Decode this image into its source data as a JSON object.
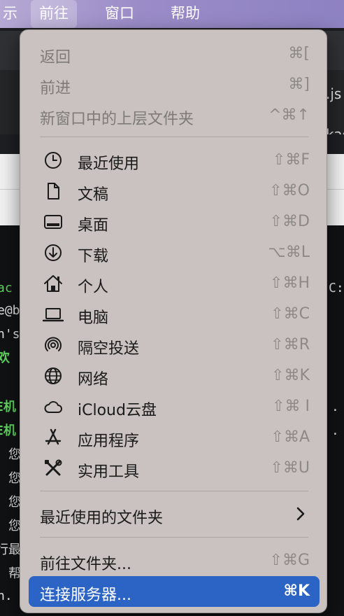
{
  "menubar": {
    "items": [
      {
        "label": "示"
      },
      {
        "label": "前往"
      },
      {
        "label": "窗口"
      },
      {
        "label": "帮助"
      }
    ]
  },
  "menu": {
    "back": {
      "label": "返回",
      "shortcut": "⌘["
    },
    "forward": {
      "label": "前进",
      "shortcut": "⌘]"
    },
    "parent": {
      "label": "新窗口中的上层文件夹",
      "shortcut": "^⌘↑"
    },
    "places": [
      {
        "label": "最近使用",
        "shortcut": "⇧⌘F",
        "icon": "clock-icon"
      },
      {
        "label": "文稿",
        "shortcut": "⇧⌘O",
        "icon": "document-icon"
      },
      {
        "label": "桌面",
        "shortcut": "⇧⌘D",
        "icon": "desktop-icon"
      },
      {
        "label": "下载",
        "shortcut": "⌥⌘L",
        "icon": "download-icon"
      },
      {
        "label": "个人",
        "shortcut": "⇧⌘H",
        "icon": "home-icon"
      },
      {
        "label": "电脑",
        "shortcut": "⇧⌘C",
        "icon": "laptop-icon"
      },
      {
        "label": "隔空投送",
        "shortcut": "⇧⌘R",
        "icon": "airdrop-icon"
      },
      {
        "label": "网络",
        "shortcut": "⇧⌘K",
        "icon": "globe-icon"
      },
      {
        "label": "iCloud云盘",
        "shortcut": "⇧⌘ I",
        "icon": "cloud-icon"
      },
      {
        "label": "应用程序",
        "shortcut": "⇧⌘A",
        "icon": "applications-icon"
      },
      {
        "label": "实用工具",
        "shortcut": "⇧⌘U",
        "icon": "utilities-icon"
      }
    ],
    "recent_folders": {
      "label": "最近使用的文件夹"
    },
    "go_to_folder": {
      "label": "前往文件夹...",
      "shortcut": "⇧⌘G"
    },
    "connect_server": {
      "label": "连接服务器...",
      "shortcut": "⌘K"
    }
  },
  "background": {
    "right_fragments": [
      ".js",
      "kag",
      "C:"
    ],
    "terminal_left": [
      "ac",
      "e@b",
      "n's",
      "欢",
      "",
      "E机",
      "E机",
      "：您",
      "：您",
      "：您",
      "：您",
      "行最",
      "：帮",
      "n."
    ],
    "terminal_right": [
      ".",
      "."
    ]
  }
}
